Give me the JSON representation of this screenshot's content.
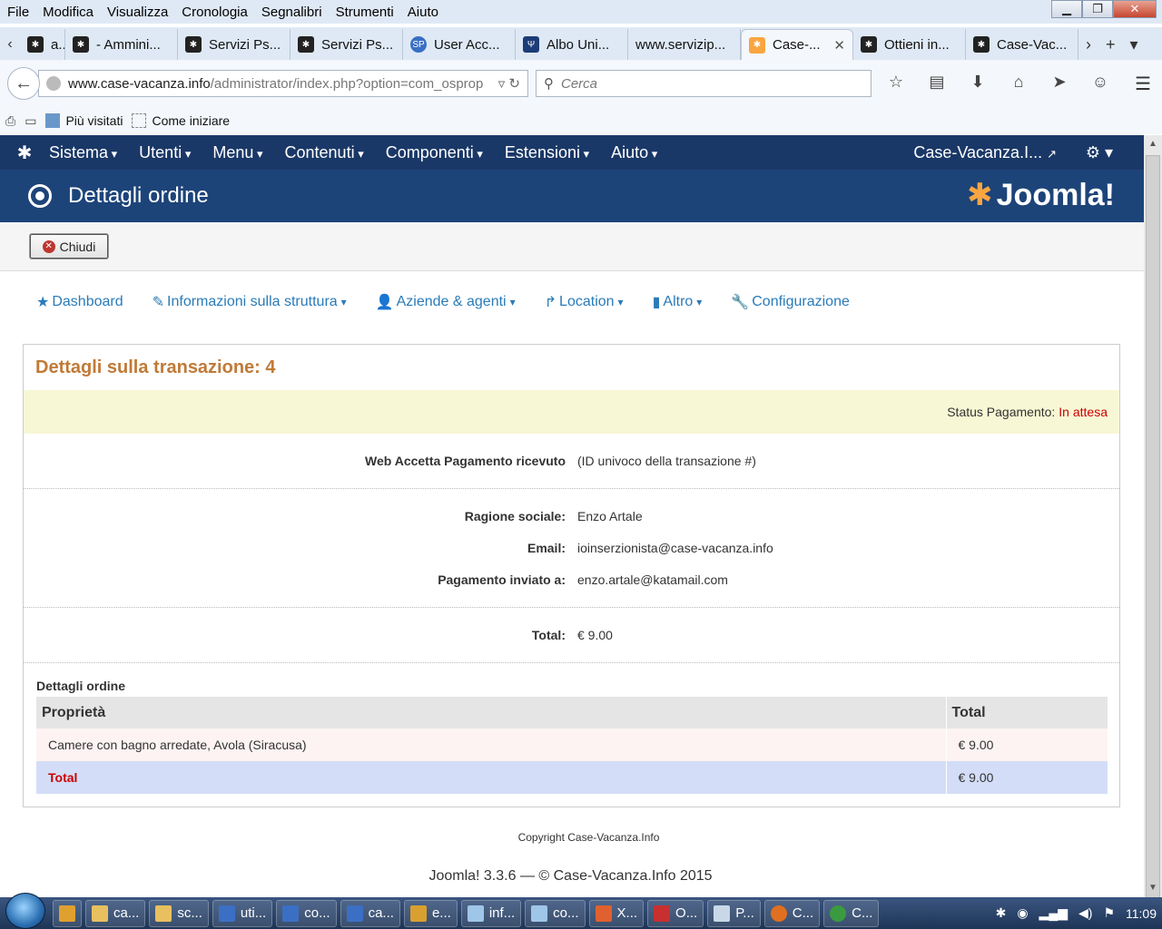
{
  "browser": {
    "menu": [
      "File",
      "Modifica",
      "Visualizza",
      "Cronologia",
      "Segnalibri",
      "Strumenti",
      "Aiuto"
    ],
    "tabs": [
      {
        "label": "a...",
        "icon": "joomla-icon"
      },
      {
        "label": "- Ammini...",
        "icon": "joomla-icon"
      },
      {
        "label": "Servizi Ps...",
        "icon": "servizi-icon"
      },
      {
        "label": "Servizi Ps...",
        "icon": "servizi-icon"
      },
      {
        "label": "User Acc...",
        "icon": "sp-icon"
      },
      {
        "label": "Albo Uni...",
        "icon": "albo-icon"
      },
      {
        "label": "www.servizip...",
        "icon": ""
      },
      {
        "label": "Case-...",
        "icon": "joomla-icon",
        "active": true
      },
      {
        "label": "Ottieni in...",
        "icon": "joomla-icon"
      },
      {
        "label": "Case-Vac...",
        "icon": "joomla-icon"
      }
    ],
    "url_host": "www.case-vacanza.info",
    "url_path": "/administrator/index.php?option=com_osprop",
    "search_placeholder": "Cerca",
    "bookmarks": [
      "Più visitati",
      "Come iniziare"
    ]
  },
  "joomla_nav": {
    "items": [
      "Sistema",
      "Utenti",
      "Menu",
      "Contenuti",
      "Componenti",
      "Estensioni",
      "Aiuto"
    ],
    "site": "Case-Vacanza.I..."
  },
  "header": {
    "title": "Dettagli ordine",
    "brand": "Joomla!"
  },
  "toolbar": {
    "close_label": "Chiudi"
  },
  "component_nav": [
    {
      "label": "Dashboard",
      "icon": "star-icon",
      "dropdown": false
    },
    {
      "label": "Informazioni sulla struttura",
      "icon": "edit-icon",
      "dropdown": true
    },
    {
      "label": "Aziende & agenti",
      "icon": "user-icon",
      "dropdown": true
    },
    {
      "label": "Location",
      "icon": "share-icon",
      "dropdown": true
    },
    {
      "label": "Altro",
      "icon": "bookmark-icon",
      "dropdown": true
    },
    {
      "label": "Configurazione",
      "icon": "wrench-icon",
      "dropdown": false
    }
  ],
  "transaction": {
    "title": "Dettagli sulla transazione: 4",
    "status_label": "Status Pagamento:",
    "status_value": "In attesa",
    "web_label": "Web Accetta Pagamento ricevuto",
    "web_value": "(ID univoco della transazione #)",
    "ragione_label": "Ragione sociale:",
    "ragione_value": "Enzo Artale",
    "email_label": "Email:",
    "email_value": "ioinserzionista@case-vacanza.info",
    "pagamento_label": "Pagamento inviato a:",
    "pagamento_value": "enzo.artale@katamail.com",
    "total_label": "Total:",
    "total_value": "€ 9.00"
  },
  "order": {
    "title": "Dettagli ordine",
    "col_property": "Proprietà",
    "col_total": "Total",
    "row_property": "Camere con bagno arredate, Avola (Siracusa)",
    "row_total": "€  9.00",
    "footer_label": "Total",
    "footer_total": "€ 9.00"
  },
  "footer": {
    "copyright": "Copyright Case-Vacanza.Info",
    "version": "Joomla! 3.3.6  —  © Case-Vacanza.Info 2015"
  },
  "taskbar": {
    "items": [
      "ca...",
      "sc...",
      "uti...",
      "co...",
      "ca...",
      "e...",
      "inf...",
      "co...",
      "X...",
      "O...",
      "P...",
      "C...",
      "C..."
    ],
    "clock": "11:09"
  }
}
